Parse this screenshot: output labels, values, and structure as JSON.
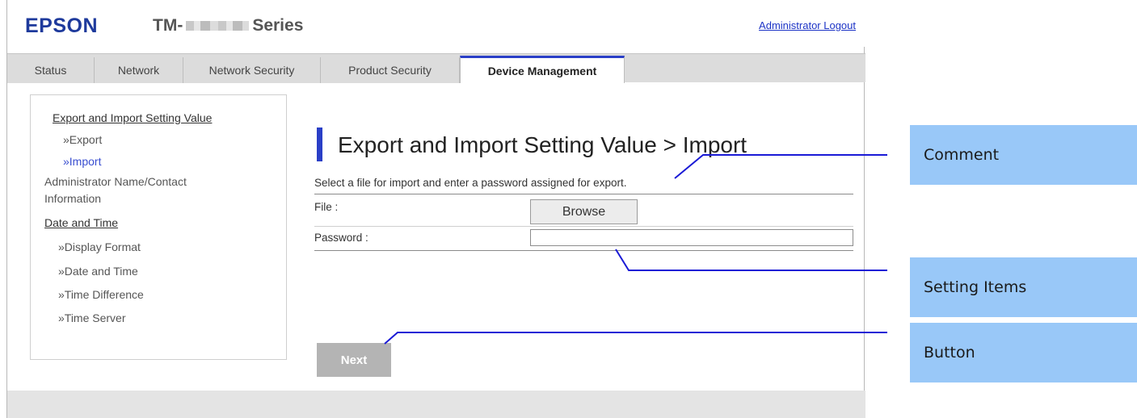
{
  "header": {
    "logo": "EPSON",
    "model_prefix": "TM-",
    "model_suffix": "Series",
    "logout_link": "Administrator Logout"
  },
  "tabs": [
    {
      "label": "Status"
    },
    {
      "label": "Network"
    },
    {
      "label": "Network Security"
    },
    {
      "label": "Product Security"
    },
    {
      "label": "Device Management",
      "active": true
    }
  ],
  "sidenav": {
    "export_import_heading": "Export and Import Setting Value",
    "export_link": "»Export",
    "import_link": "»Import",
    "admin_line1": "Administrator Name/Contact",
    "admin_line2": "Information",
    "date_heading": "Date and Time",
    "display_format": "»Display Format",
    "date_and_time": "»Date and Time",
    "time_difference": "»Time Difference",
    "time_server": "»Time Server"
  },
  "main": {
    "page_title": "Export and Import Setting Value > Import",
    "comment": "Select a file for import and enter a password assigned for export.",
    "file_label": "File :",
    "browse_button": "Browse",
    "password_label": "Password :",
    "password_value": "",
    "next_button": "Next"
  },
  "callouts": {
    "comment": "Comment",
    "setting_items": "Setting Items",
    "button": "Button"
  },
  "colors": {
    "accent": "#2a3fc7",
    "callout_box": "#99c8f8",
    "callout_line": "#1a1ad6",
    "logo": "#1e3a9c"
  }
}
